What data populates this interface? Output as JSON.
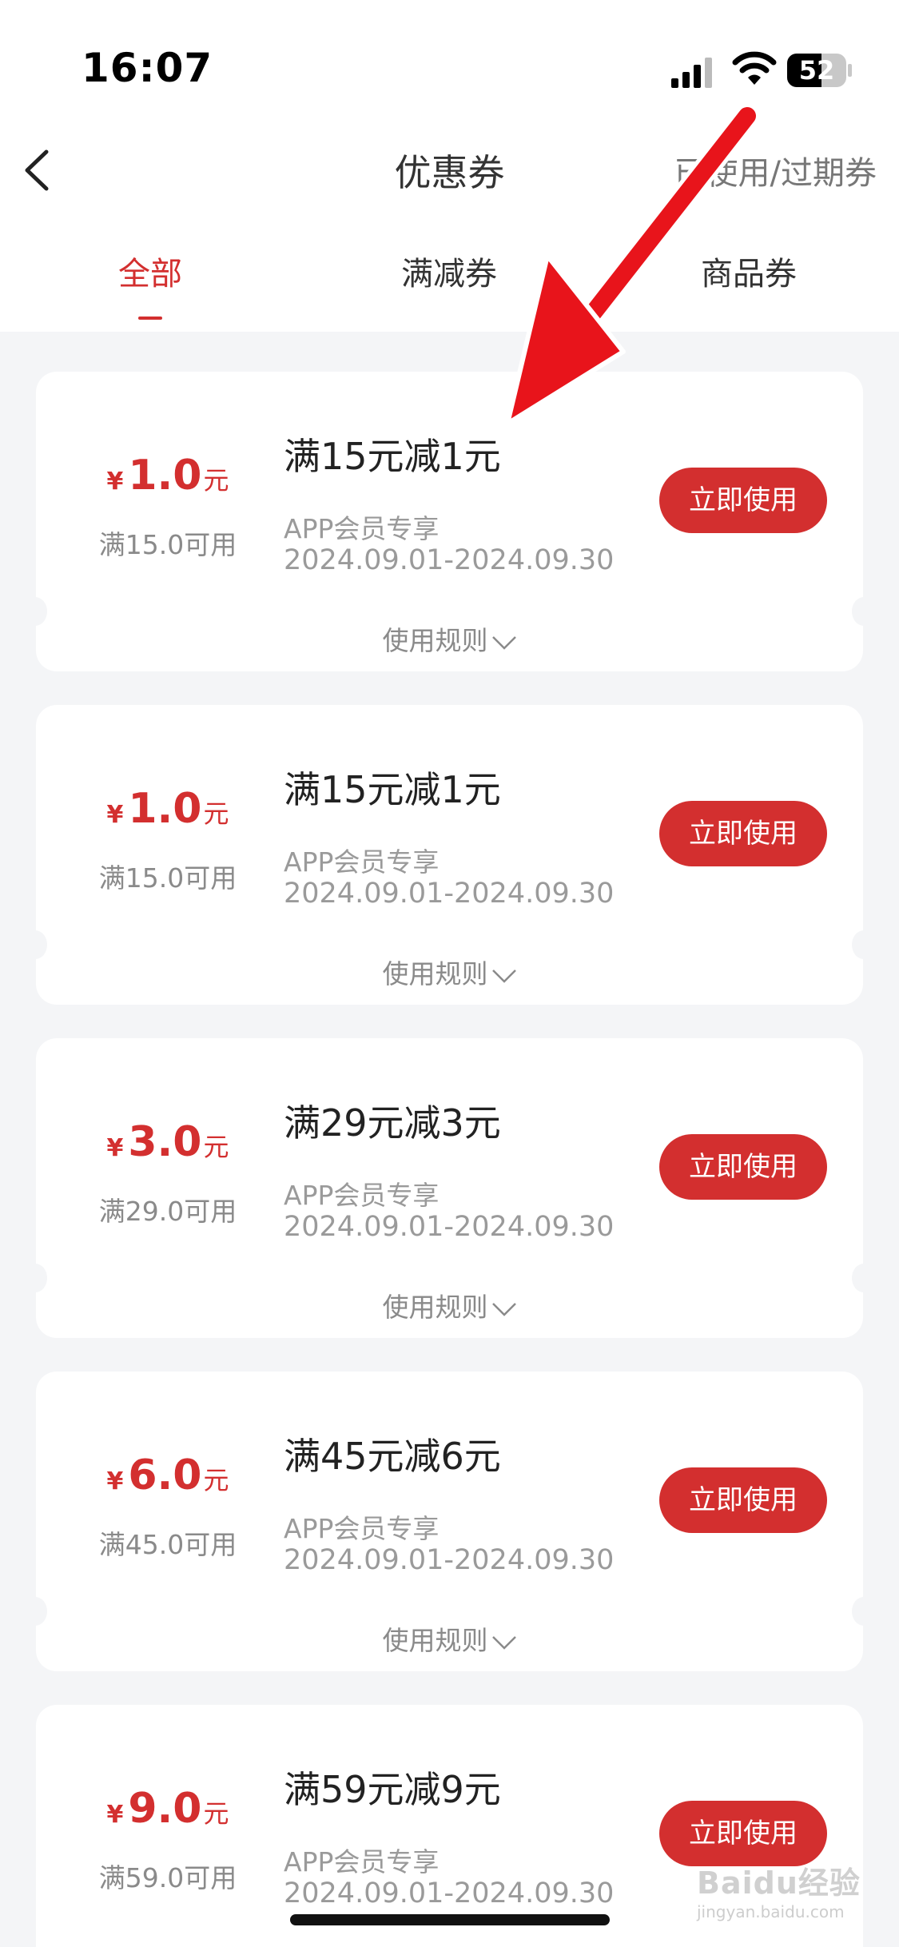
{
  "status_bar": {
    "time": "16:07",
    "battery": "52",
    "icons": [
      "signal-icon",
      "wifi-icon",
      "battery-icon"
    ]
  },
  "header": {
    "back_icon": "back-arrow-icon",
    "title": "优惠券",
    "expired_link": "已使用/过期券"
  },
  "tabs": [
    {
      "label": "全部",
      "active": true
    },
    {
      "label": "满减券",
      "active": false
    },
    {
      "label": "商品券",
      "active": false
    }
  ],
  "coupons": [
    {
      "yen": "¥",
      "amount": "1.0",
      "unit": "元",
      "min_spend": "满15.0可用",
      "title": "满15元减1元",
      "member_tag": "APP会员专享",
      "valid_dates": "2024.09.01-2024.09.30",
      "button_label": "立即使用",
      "rules_label": "使用规则"
    },
    {
      "yen": "¥",
      "amount": "1.0",
      "unit": "元",
      "min_spend": "满15.0可用",
      "title": "满15元减1元",
      "member_tag": "APP会员专享",
      "valid_dates": "2024.09.01-2024.09.30",
      "button_label": "立即使用",
      "rules_label": "使用规则"
    },
    {
      "yen": "¥",
      "amount": "3.0",
      "unit": "元",
      "min_spend": "满29.0可用",
      "title": "满29元减3元",
      "member_tag": "APP会员专享",
      "valid_dates": "2024.09.01-2024.09.30",
      "button_label": "立即使用",
      "rules_label": "使用规则"
    },
    {
      "yen": "¥",
      "amount": "6.0",
      "unit": "元",
      "min_spend": "满45.0可用",
      "title": "满45元减6元",
      "member_tag": "APP会员专享",
      "valid_dates": "2024.09.01-2024.09.30",
      "button_label": "立即使用",
      "rules_label": "使用规则"
    },
    {
      "yen": "¥",
      "amount": "9.0",
      "unit": "元",
      "min_spend": "满59.0可用",
      "title": "满59元减9元",
      "member_tag": "APP会员专享",
      "valid_dates": "2024.09.01-2024.09.30",
      "button_label": "立即使用",
      "rules_label": "使用规则"
    }
  ],
  "annotation": {
    "icon": "red-arrow-icon",
    "color": "#e8141b"
  },
  "watermark": {
    "text": "Baidu经验",
    "sub": "jingyan.baidu.com"
  },
  "colors": {
    "accent": "#d32f2f",
    "background": "#f4f5f7",
    "card": "#ffffff"
  }
}
